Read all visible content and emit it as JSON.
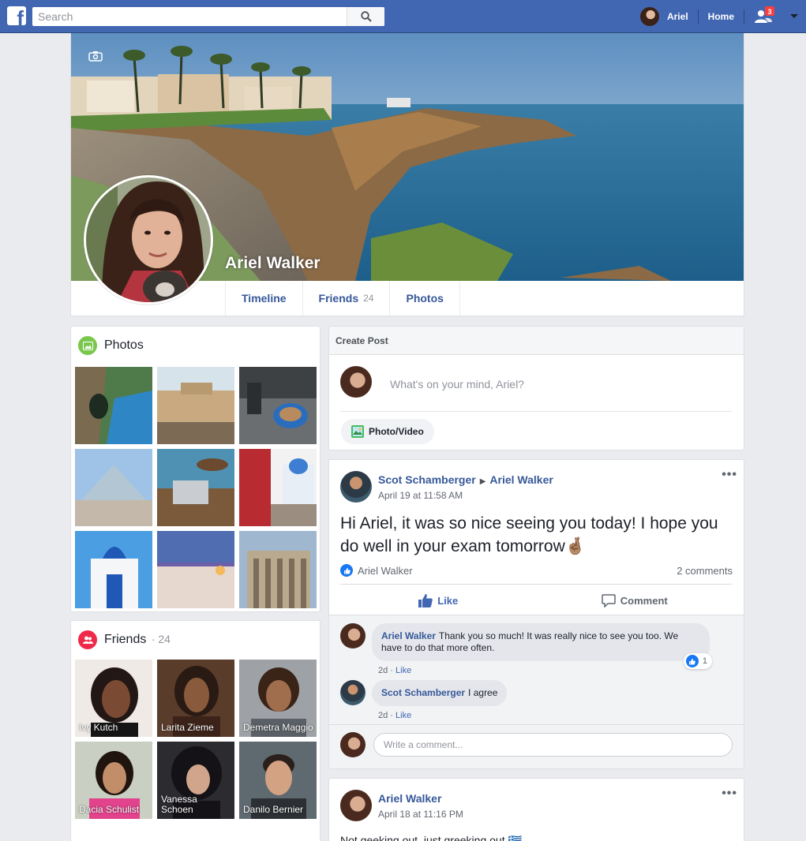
{
  "topbar": {
    "logo": "f",
    "search_placeholder": "Search",
    "user_name": "Ariel",
    "home_label": "Home",
    "friend_requests_badge": "3"
  },
  "profile": {
    "name": "Ariel Walker",
    "tabs": [
      {
        "label": "Timeline",
        "count": ""
      },
      {
        "label": "Friends",
        "count": "24"
      },
      {
        "label": "Photos",
        "count": ""
      }
    ]
  },
  "photos_card": {
    "title": "Photos"
  },
  "friends_card": {
    "title": "Friends",
    "count": "· 24",
    "friends": [
      {
        "name": "Ivy Kutch"
      },
      {
        "name": "Larita Zieme"
      },
      {
        "name": "Demetra Maggio"
      },
      {
        "name": "Dacia Schulist"
      },
      {
        "name": "Vanessa Schoen"
      },
      {
        "name": "Danilo Bernier"
      }
    ]
  },
  "create_post": {
    "title": "Create Post",
    "placeholder": "What's on your mind, Ariel?",
    "photo_video_label": "Photo/Video"
  },
  "post1": {
    "author": "Scot Schamberger",
    "target": "Ariel Walker",
    "time": "April 19 at 11:58 AM",
    "text": "Hi Ariel, it was so nice seeing you today! I hope you do well in your exam tomorrow🤞🏽",
    "liked_by": "Ariel Walker",
    "comments_count": "2 comments",
    "like_label": "Like",
    "comment_label": "Comment",
    "comments": [
      {
        "author": "Ariel Walker",
        "text": "Thank you so much! It was really nice to see you too. We have to do that more often.",
        "age": "2d",
        "like": "Like",
        "likes": "1"
      },
      {
        "author": "Scot Schamberger",
        "text": "I agree",
        "age": "2d",
        "like": "Like"
      }
    ],
    "write_placeholder": "Write a comment..."
  },
  "post2": {
    "author": "Ariel Walker",
    "time": "April 18 at 11:16 PM",
    "text_partial": "Not geeking out, just greeking out 🇬🇷"
  },
  "colors": {
    "brand": "#4267b2",
    "link": "#365899",
    "badge": "#fa3e3e",
    "photos_icon": "#7ac74f",
    "friends_icon": "#f02849"
  }
}
